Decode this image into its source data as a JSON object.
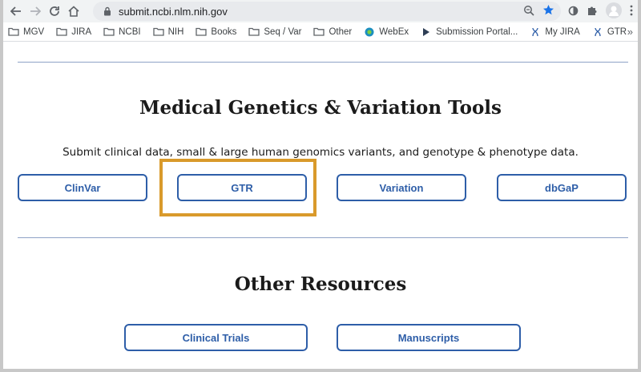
{
  "browser": {
    "url": "submit.ncbi.nlm.nih.gov",
    "bookmarks": [
      {
        "label": "MGV",
        "icon": "folder-icon"
      },
      {
        "label": "JIRA",
        "icon": "folder-icon"
      },
      {
        "label": "NCBI",
        "icon": "folder-icon"
      },
      {
        "label": "NIH",
        "icon": "folder-icon"
      },
      {
        "label": "Books",
        "icon": "folder-icon"
      },
      {
        "label": "Seq / Var",
        "icon": "folder-icon"
      },
      {
        "label": "Other",
        "icon": "folder-icon"
      },
      {
        "label": "WebEx",
        "icon": "webex-icon"
      },
      {
        "label": "Submission Portal...",
        "icon": "submission-portal-icon"
      },
      {
        "label": "My JIRA",
        "icon": "dna-icon"
      },
      {
        "label": "GTR",
        "icon": "dna-icon"
      }
    ],
    "more_label": "»"
  },
  "section1": {
    "title": "Medical Genetics & Variation Tools",
    "description": "Submit clinical data, small & large human genomics variants, and genotype & phenotype data.",
    "buttons": [
      "ClinVar",
      "GTR",
      "Variation",
      "dbGaP"
    ]
  },
  "section2": {
    "title": "Other Resources",
    "buttons": [
      "Clinical Trials",
      "Manuscripts"
    ]
  },
  "colors": {
    "button_border": "#2e5ea8",
    "highlight": "#d99a2b",
    "divider": "#8fa2c6"
  }
}
